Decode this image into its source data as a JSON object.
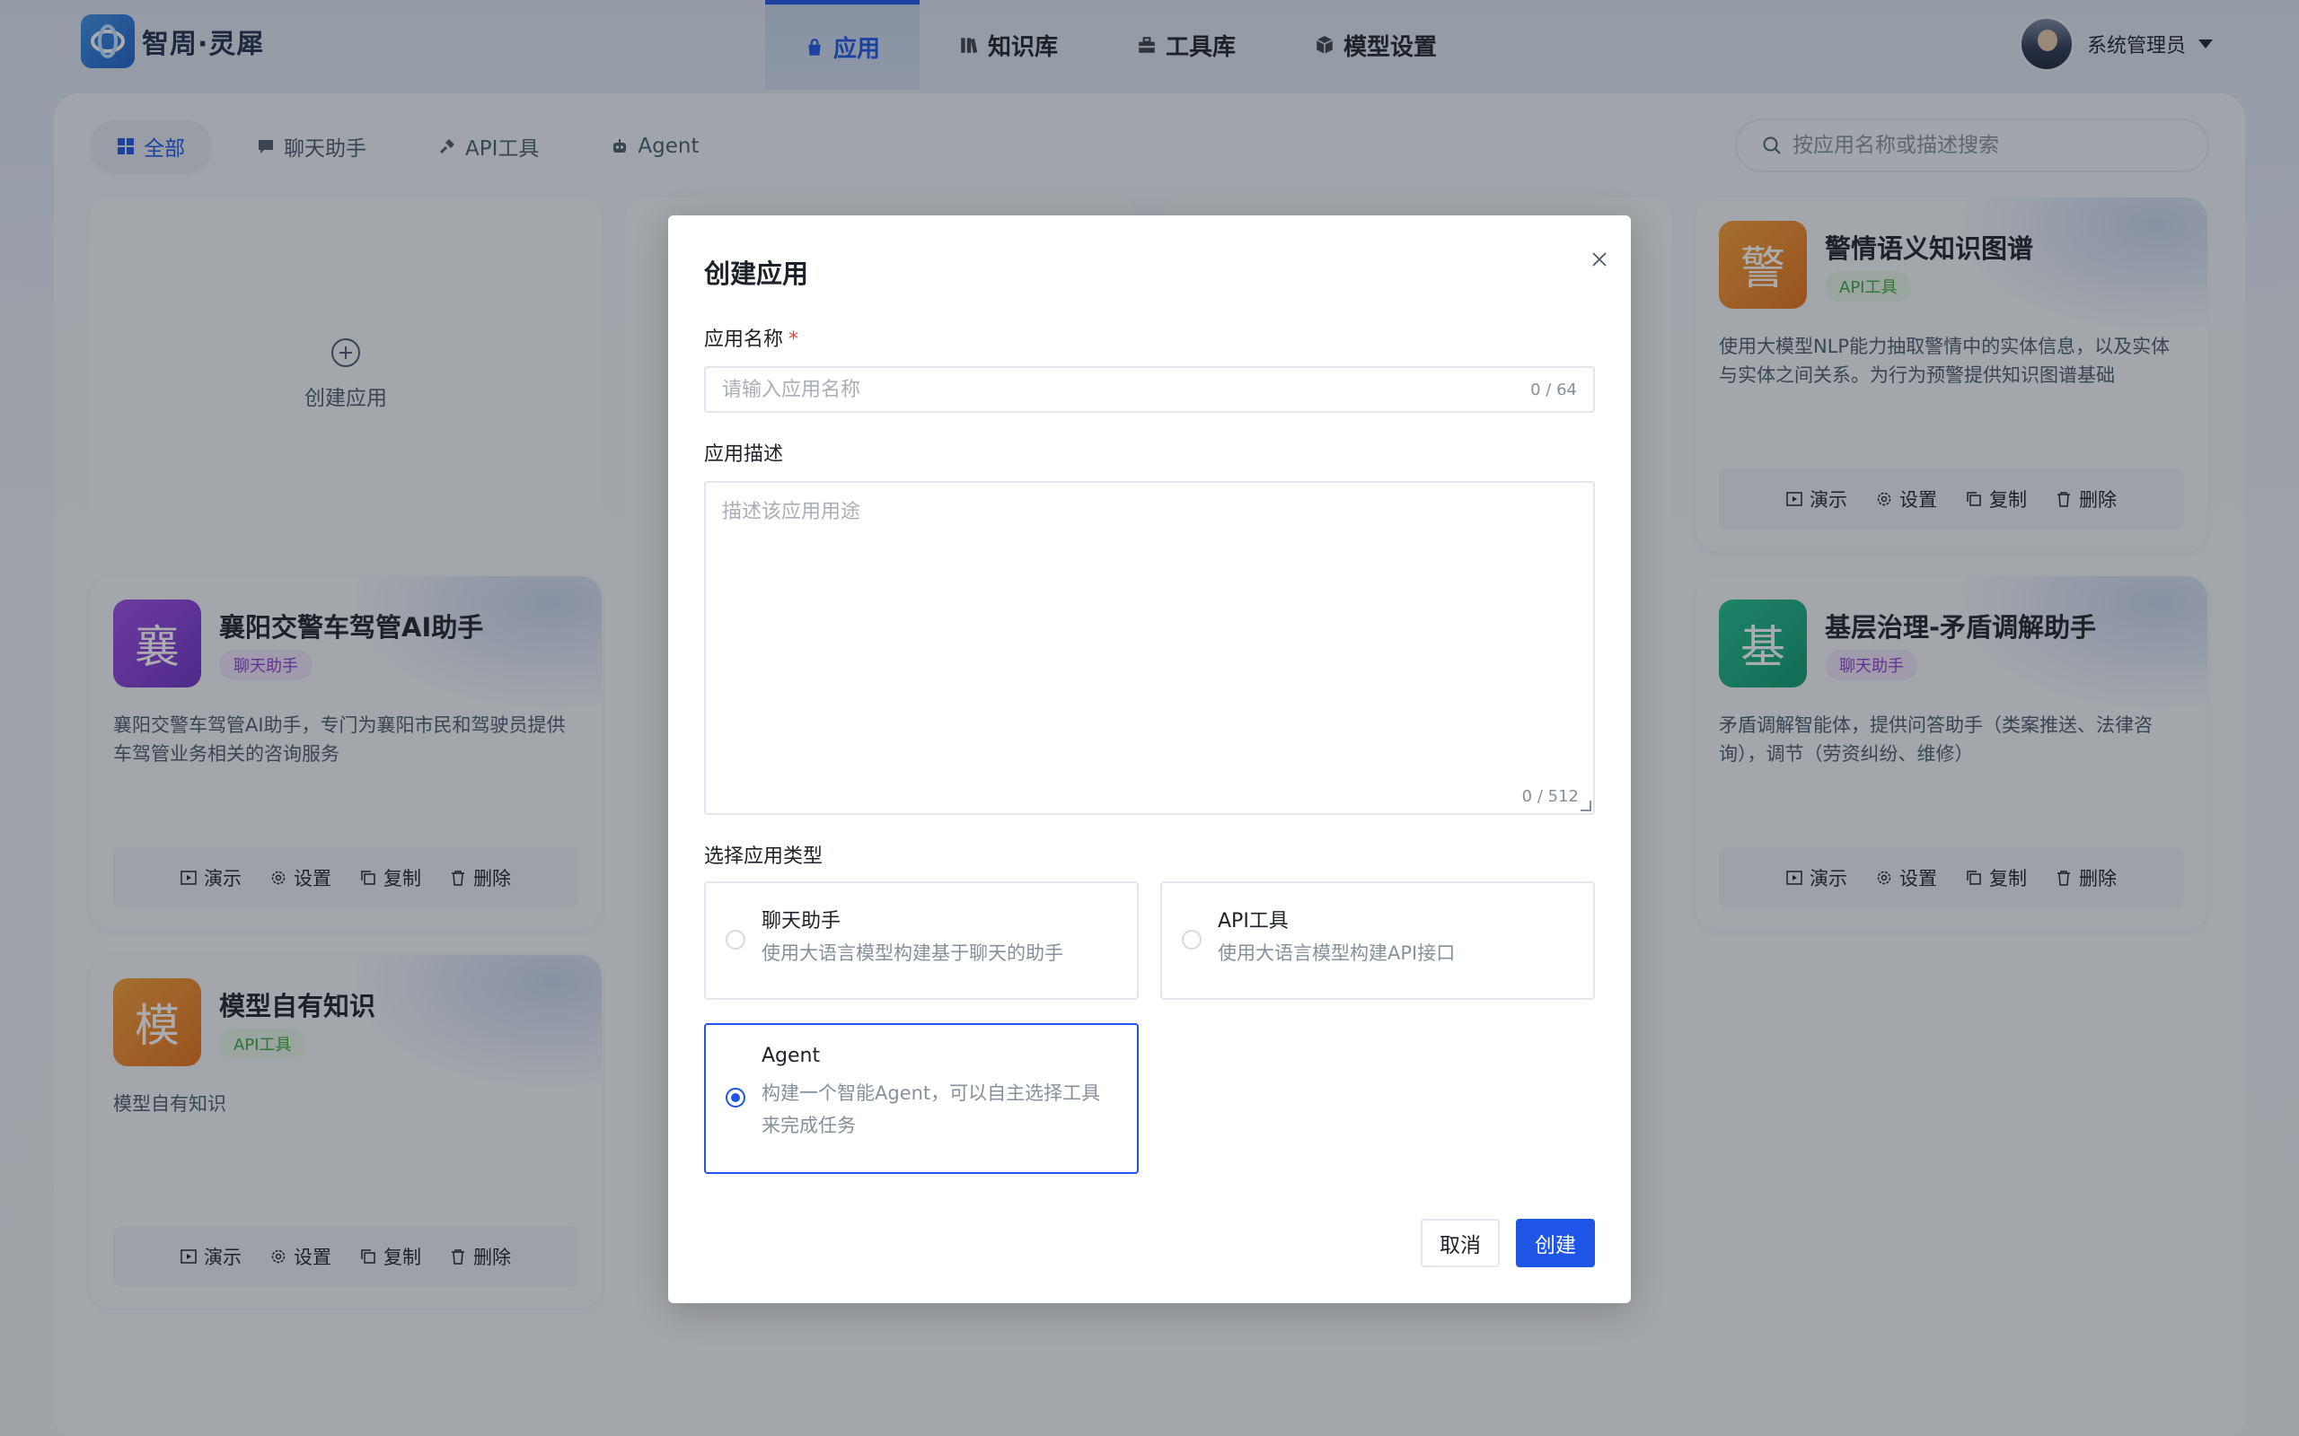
{
  "app": {
    "logo_text": "智周·灵犀"
  },
  "nav": {
    "items": [
      {
        "label": "应用",
        "icon": "bag-icon",
        "active": true
      },
      {
        "label": "知识库",
        "icon": "books-icon",
        "active": false
      },
      {
        "label": "工具库",
        "icon": "toolbox-icon",
        "active": false
      },
      {
        "label": "模型设置",
        "icon": "cube-icon",
        "active": false
      }
    ]
  },
  "user": {
    "name": "系统管理员"
  },
  "filters": {
    "items": [
      {
        "label": "全部",
        "icon": "grid-icon",
        "active": true
      },
      {
        "label": "聊天助手",
        "icon": "chat-icon",
        "active": false
      },
      {
        "label": "API工具",
        "icon": "plug-icon",
        "active": false
      },
      {
        "label": "Agent",
        "icon": "robot-icon",
        "active": false
      }
    ]
  },
  "search": {
    "placeholder": "按应用名称或描述搜索"
  },
  "create_card": {
    "label": "创建应用"
  },
  "cards": [
    {
      "icon_char": "警",
      "icon_color": "#ef7d1a",
      "title": "警情语义知识图谱",
      "tag": "API工具",
      "tag_kind": "api",
      "desc": "使用大模型NLP能力抽取警情中的实体信息，以及实体与实体之间关系。为行为预警提供知识图谱基础"
    },
    {
      "icon_char": "襄",
      "icon_color": "#8b3fd6",
      "title": "襄阳交警车驾管AI助手",
      "tag": "聊天助手",
      "tag_kind": "chat",
      "desc": "襄阳交警车驾管AI助手，专门为襄阳市民和驾驶员提供车驾管业务相关的咨询服务"
    },
    {
      "icon_char": "基",
      "icon_color": "#12a77d",
      "title": "基层治理-矛盾调解助手",
      "tag": "聊天助手",
      "tag_kind": "chat",
      "desc": "矛盾调解智能体，提供问答助手（类案推送、法律咨询），调节（劳资纠纷、维修）"
    },
    {
      "icon_char": "模",
      "icon_color": "#ef7d1a",
      "title": "模型自有知识",
      "tag": "API工具",
      "tag_kind": "api",
      "desc": "模型自有知识"
    }
  ],
  "card_actions": {
    "demo": "演示",
    "settings": "设置",
    "copy": "复制",
    "delete": "删除"
  },
  "modal": {
    "title": "创建应用",
    "name_label": "应用名称",
    "name_required_mark": "*",
    "name_placeholder": "请输入应用名称",
    "name_value": "",
    "name_counter": "0 / 64",
    "desc_label": "应用描述",
    "desc_placeholder": "描述该应用用途",
    "desc_value": "",
    "desc_counter": "0 / 512",
    "type_label": "选择应用类型",
    "types": [
      {
        "title": "聊天助手",
        "desc": "使用大语言模型构建基于聊天的助手",
        "selected": false
      },
      {
        "title": "API工具",
        "desc": "使用大语言模型构建API接口",
        "selected": false
      },
      {
        "title": "Agent",
        "desc": "构建一个智能Agent，可以自主选择工具来完成任务",
        "selected": true
      }
    ],
    "cancel_label": "取消",
    "create_label": "创建"
  },
  "colors": {
    "accent": "#1e55e6",
    "required": "#f53f3f"
  }
}
